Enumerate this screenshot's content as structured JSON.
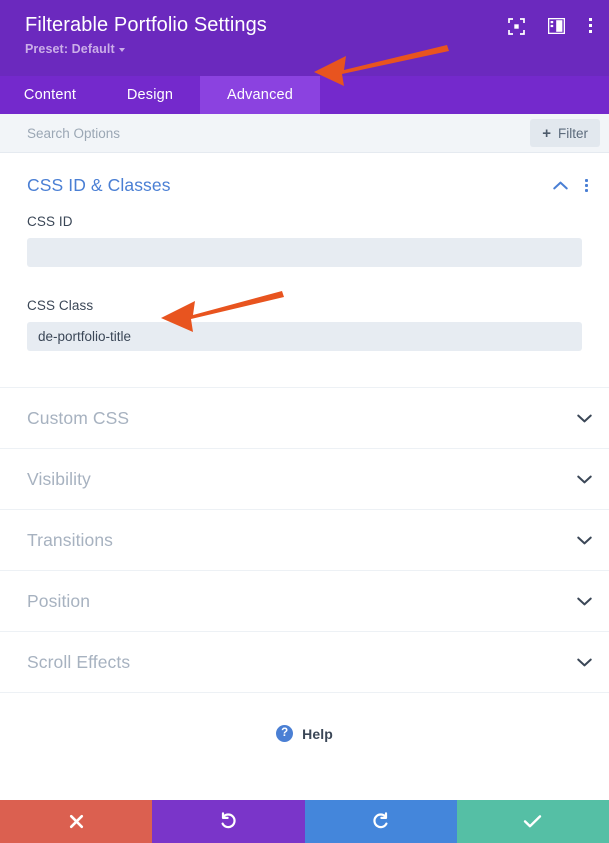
{
  "header": {
    "title": "Filterable Portfolio Settings",
    "preset_label": "Preset: Default",
    "icons": [
      {
        "name": "focus-icon",
        "glyph": "focus"
      },
      {
        "name": "layout-panel-icon",
        "glyph": "panel"
      },
      {
        "name": "more-options-icon",
        "glyph": "dots-vertical"
      }
    ],
    "colors": {
      "background": "#6B29BE",
      "title": "#FFFFFF",
      "preset": "#CBAEE8"
    }
  },
  "tabs": {
    "items": [
      {
        "label": "Content",
        "active": false
      },
      {
        "label": "Design",
        "active": false
      },
      {
        "label": "Advanced",
        "active": true
      }
    ],
    "colors": {
      "bar": "#7429CC",
      "active": "#8B42E0",
      "text": "#FFFFFF"
    }
  },
  "search": {
    "placeholder": "Search Options",
    "value": "",
    "filter_label": "Filter",
    "plus_glyph": "+"
  },
  "open_section": {
    "title": "CSS ID & Classes",
    "collapse_icon": "chevron-up-icon",
    "menu_icon": "more-options-icon",
    "fields": [
      {
        "label": "CSS ID",
        "value": "",
        "name": "css-id-field"
      },
      {
        "label": "CSS Class",
        "value": "de-portfolio-title",
        "name": "css-class-field"
      }
    ],
    "accent_color": "#4A7FD4"
  },
  "collapsed_sections": [
    {
      "label": "Custom CSS"
    },
    {
      "label": "Visibility"
    },
    {
      "label": "Transitions"
    },
    {
      "label": "Position"
    },
    {
      "label": "Scroll Effects"
    }
  ],
  "help": {
    "label": "Help",
    "icon_glyph": "?"
  },
  "footer": {
    "buttons": [
      {
        "name": "discard-button",
        "glyph": "✕",
        "color": "#DB6050"
      },
      {
        "name": "undo-button",
        "glyph": "↺",
        "color": "#7A35C9"
      },
      {
        "name": "redo-button",
        "glyph": "↻",
        "color": "#4486DB"
      },
      {
        "name": "save-button",
        "glyph": "✓",
        "color": "#55BFA5"
      }
    ]
  },
  "annotations": {
    "arrow_color": "#E8541F",
    "arrows": [
      {
        "name": "arrow-pointing-to-advanced-tab"
      },
      {
        "name": "arrow-pointing-to-css-class-field"
      }
    ]
  }
}
